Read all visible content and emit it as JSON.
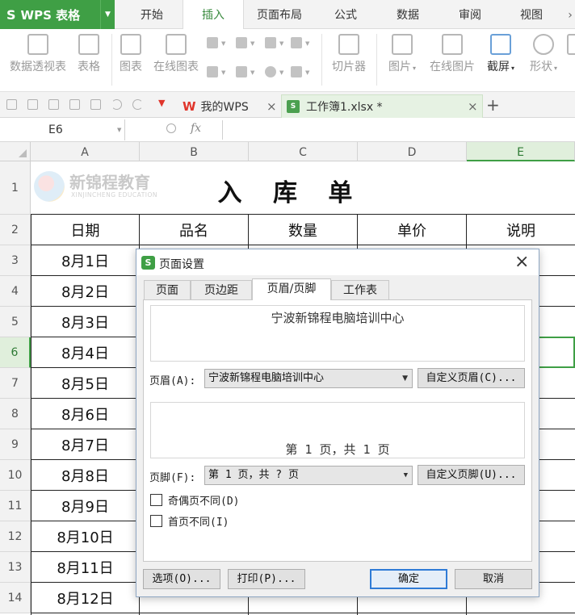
{
  "app": {
    "name": "WPS 表格"
  },
  "menu": {
    "tabs": [
      "开始",
      "插入",
      "页面布局",
      "公式",
      "数据",
      "审阅",
      "视图"
    ],
    "active": "插入"
  },
  "ribbon": {
    "pivot": "数据透视表",
    "table": "表格",
    "chart": "图表",
    "online_chart": "在线图表",
    "slicer": "切片器",
    "picture": "图片",
    "online_picture": "在线图片",
    "screenshot": "截屏",
    "shapes": "形状"
  },
  "doc_tabs": [
    {
      "label": "我的WPS"
    },
    {
      "label": "工作簿1.xlsx *",
      "active": true
    }
  ],
  "formula_bar": {
    "cell_ref": "E6",
    "fx": "fx",
    "value": ""
  },
  "sheet": {
    "columns": [
      "A",
      "B",
      "C",
      "D",
      "E"
    ],
    "selected_column": "E",
    "rows": [
      "1",
      "2",
      "3",
      "4",
      "5",
      "6",
      "7",
      "8",
      "9",
      "10",
      "11",
      "12",
      "13",
      "14"
    ],
    "selected_row": "6",
    "title": "入 库 单",
    "watermark": {
      "name": "新锦程教育",
      "sub": "XINJINCHENG EDUCATION"
    },
    "headers": [
      "日期",
      "品名",
      "数量",
      "单价",
      "说明"
    ],
    "dates": [
      "8月1日",
      "8月2日",
      "8月3日",
      "8月4日",
      "8月5日",
      "8月6日",
      "8月7日",
      "8月8日",
      "8月9日",
      "8月10日",
      "8月11日",
      "8月12日"
    ]
  },
  "dialog": {
    "title": "页面设置",
    "tabs": [
      "页面",
      "页边距",
      "页眉/页脚",
      "工作表"
    ],
    "active_tab": "页眉/页脚",
    "header_preview": "宁波新锦程电脑培训中心",
    "header_label": "页眉(A):",
    "header_value": "宁波新锦程电脑培训中心",
    "custom_header": "自定义页眉(C)...",
    "footer_preview": "第 1 页，共 1 页",
    "footer_label": "页脚(F):",
    "footer_value": "第 1 页，共 ? 页",
    "custom_footer": "自定义页脚(U)...",
    "odd_even": "奇偶页不同(D)",
    "first_page": "首页不同(I)",
    "options": "选项(O)...",
    "print": "打印(P)...",
    "ok": "确定",
    "cancel": "取消",
    "close": "×"
  },
  "colors": {
    "accent": "#3f9f45",
    "wps_red": "#e0352b"
  }
}
